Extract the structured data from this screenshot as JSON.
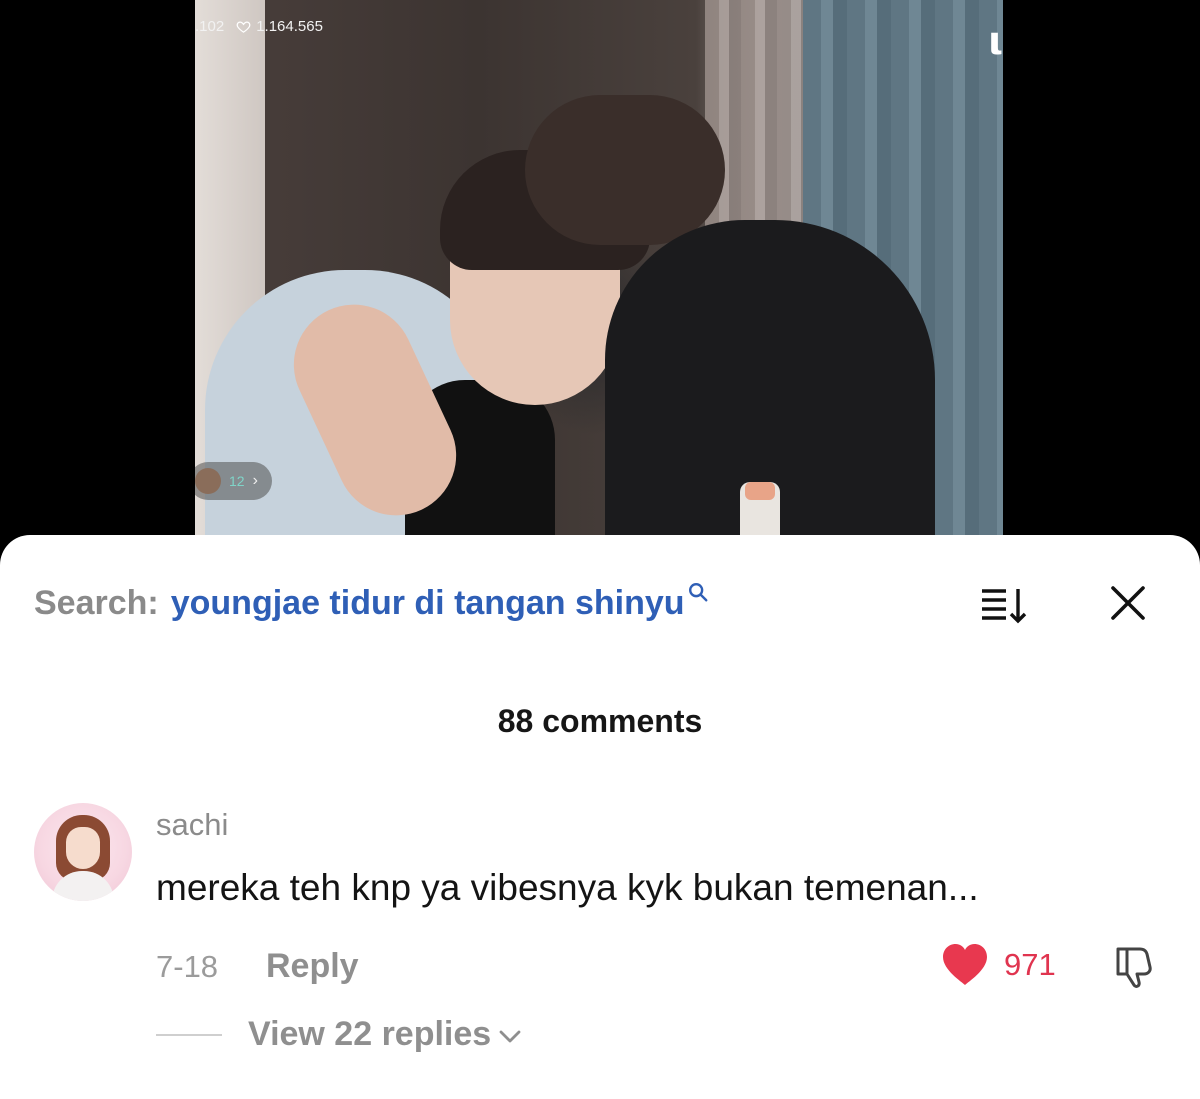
{
  "video": {
    "viewer_count": ".102",
    "like_count": "1.164.565",
    "viewers_badge": "12",
    "corner_logo": "ι"
  },
  "sheet": {
    "search_label": "Search:",
    "search_query": "youngjae tidur di tangan shinyu",
    "comment_count": "88 comments"
  },
  "comments": [
    {
      "username": "sachi",
      "text": "mereka teh knp ya vibesnya kyk bukan temenan...",
      "date": "7-18",
      "reply_label": "Reply",
      "likes": "971",
      "view_replies": "View 22 replies"
    }
  ],
  "colors": {
    "search_query": "#2f5fb6",
    "like_heart": "#e8384f",
    "muted_text": "#8f8f8f"
  },
  "icons": [
    "heart-outline-icon",
    "search-icon",
    "sort-icon",
    "close-icon",
    "heart-filled-icon",
    "dislike-icon",
    "chevron-down-icon",
    "chevron-right-icon"
  ]
}
